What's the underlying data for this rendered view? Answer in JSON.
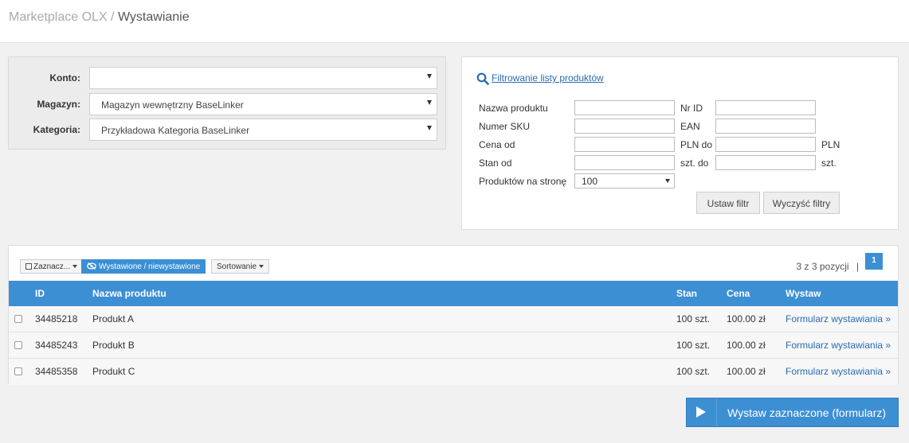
{
  "breadcrumb": {
    "parent": "Marketplace OLX",
    "separator": " / ",
    "current": "Wystawianie"
  },
  "selectors": [
    {
      "label": "Konto:",
      "value": ""
    },
    {
      "label": "Magazyn:",
      "value": "Magazyn wewnętrzny BaseLinker"
    },
    {
      "label": "Kategoria:",
      "value": "Przykładowa Kategoria BaseLinker"
    }
  ],
  "filter": {
    "title": "Filtrowanie listy produktów",
    "fields": {
      "name_label": "Nazwa produktu",
      "id_label": "Nr ID",
      "sku_label": "Numer SKU",
      "ean_label": "EAN",
      "price_from_label": "Cena od",
      "price_to_label": "PLN do",
      "price_unit": "PLN",
      "stock_from_label": "Stan od",
      "stock_to_label": "szt. do",
      "stock_unit": "szt.",
      "per_page_label": "Produktów na stronę",
      "per_page_value": "100"
    },
    "apply_button": "Ustaw filtr",
    "clear_button": "Wyczyść filtry"
  },
  "toolbar": {
    "select_label": "Zaznacz...",
    "listed_toggle": "Wystawione / niewystawione",
    "sort_label": "Sortowanie"
  },
  "pagination": {
    "count_text": "3 z 3 pozycji",
    "separator": "|",
    "page": "1"
  },
  "table": {
    "headers": {
      "id": "ID",
      "name": "Nazwa produktu",
      "stock": "Stan",
      "price": "Cena",
      "list": "Wystaw"
    },
    "rows": [
      {
        "id": "34485218",
        "name": "Produkt A",
        "stock": "100 szt.",
        "price": "100.00 zł",
        "action": "Formularz wystawiania »"
      },
      {
        "id": "34485243",
        "name": "Produkt B",
        "stock": "100 szt.",
        "price": "100.00 zł",
        "action": "Formularz wystawiania »"
      },
      {
        "id": "34485358",
        "name": "Produkt C",
        "stock": "100 szt.",
        "price": "100.00 zł",
        "action": "Formularz wystawiania »"
      }
    ]
  },
  "action_button": "Wystaw zaznaczone (formularz)",
  "icons": {
    "filter_title": "search-icon",
    "toggle": "eye-slash-icon",
    "action": "play-icon",
    "select": "checkbox-icon"
  },
  "colors": {
    "accent": "#3d8fd4",
    "link": "#2a6cb0"
  }
}
